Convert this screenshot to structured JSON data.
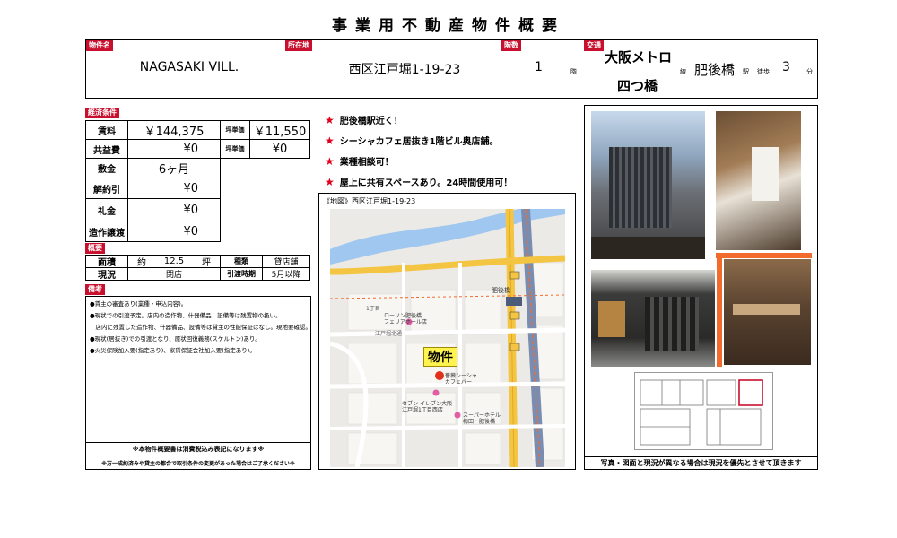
{
  "title": "事業用不動産物件概要",
  "header": {
    "name_tag": "物件名",
    "name": "NAGASAKI VILL.",
    "loc_tag": "所在地",
    "location": "西区江戸堀1-19-23",
    "floor_tag": "階数",
    "floor": "1",
    "floor_unit": "階",
    "traffic_tag": "交通",
    "line": "大阪メトロ",
    "line2": "四つ橋",
    "line_unit": "線",
    "station": "肥後橋",
    "station_unit": "駅",
    "walk": "徒歩",
    "minutes": "3",
    "min_unit": "分"
  },
  "economic": {
    "tag": "経済条件",
    "rent_label": "賃料",
    "rent": "￥144,375",
    "tsubo_label": "坪単価",
    "rent_tsubo": "￥11,550",
    "common_label": "共益費",
    "common": "¥0",
    "common_tsubo": "¥0",
    "deposit_label": "敷金",
    "deposit": "6ヶ月",
    "cancel_label": "解約引",
    "cancel": "¥0",
    "key_label": "礼金",
    "key": "¥0",
    "transfer_label": "造作譲渡",
    "transfer": "¥0"
  },
  "summary": {
    "tag": "概要",
    "area_label": "面積",
    "area_prefix": "約",
    "area": "12.5",
    "area_unit": "坪",
    "type_label": "種類",
    "type": "貸店舗",
    "status_label": "現況",
    "status": "閉店",
    "handover_label": "引渡時期",
    "handover": "5月以降"
  },
  "remarks": {
    "tag": "備考",
    "lines": [
      "●賃主の審査あり(業種・申込内容)。",
      "●現状での引渡予定。店内の造作物、什器備品、設備等は残置物の扱い。",
      "　店内に残置した造作物、什器備品、設備等は貸主の性能保証はなし。現地要確認。",
      "●現状(居抜き)での引渡となり、原状回復義務(スケルトン)あり。",
      "●火災保険加入要(指定あり)、家賃保証会社加入要(指定あり)。"
    ],
    "footer1": "※本物件概要書は消費税込み表記になります※",
    "footer2": "※万一成約済みや貸主の都合で取引条件の変更があった場合はご了承ください※"
  },
  "features": [
    "肥後橋駅近く！",
    "シーシャカフェ居抜き1階ビル奥店舗。",
    "業種相談可！",
    "屋上に共有スペースあり。24時間使用可！"
  ],
  "map": {
    "caption": "《地図》西区江戸堀1-19-23",
    "marker": "物件",
    "labels": {
      "lawson": "ローソン肥後橋",
      "lawson2": "フェリアホール店",
      "seven": "セブン-イレブン大阪",
      "seven2": "江戸堀1丁目西店",
      "hotel": "スーパーホテル",
      "hotel2": "梅田・肥後橋",
      "shop": "薔薇シーシャ",
      "shop2": "カフェバー",
      "higobashi": "肥後橋",
      "chome": "1丁目",
      "edobori": "江戸堀北通"
    }
  },
  "photos": {
    "caption": "写真・図面と現況が異なる場合は現況を優先とさせて頂きます"
  },
  "colors": {
    "accent_red": "#c8102e",
    "map_road": "#f4c542",
    "map_river": "#9fc7ef",
    "frame": "#f26b2c"
  }
}
